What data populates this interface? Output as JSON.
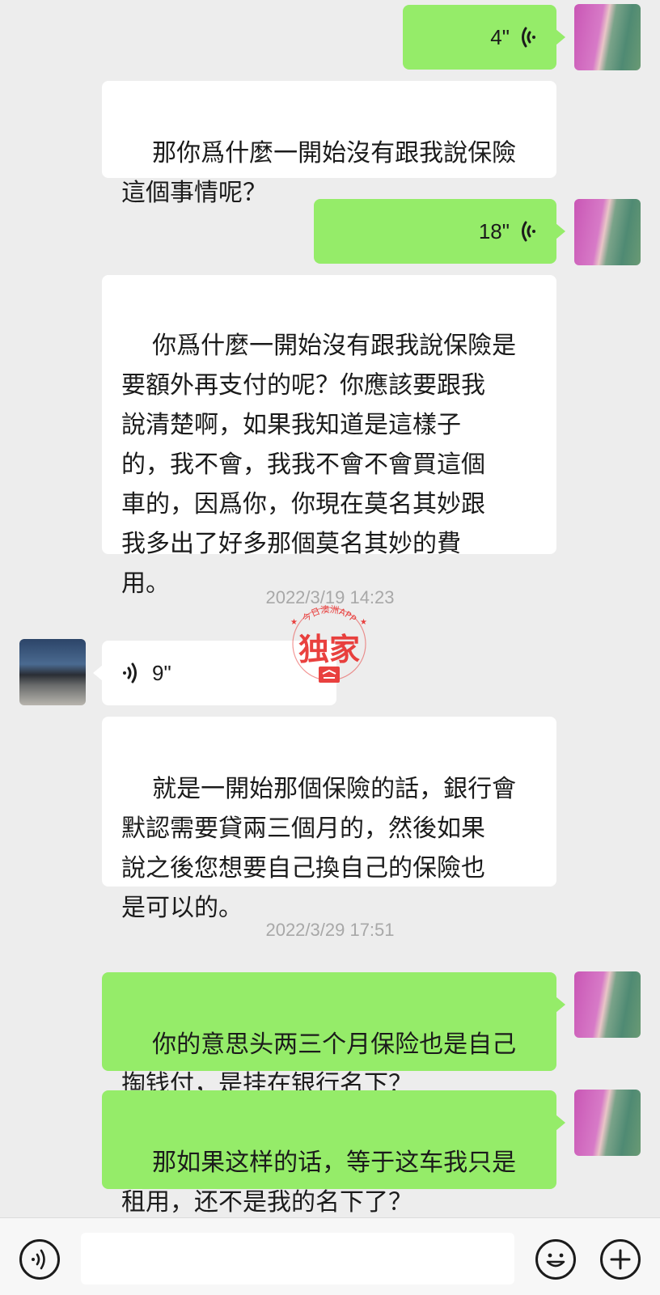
{
  "messages": [
    {
      "type": "voice",
      "from": "me",
      "duration": "4\""
    },
    {
      "type": "text",
      "from": "other",
      "text": "那你爲什麼一開始沒有跟我說保險\n這個事情呢？"
    },
    {
      "type": "voice",
      "from": "me",
      "duration": "18\""
    },
    {
      "type": "text",
      "from": "other",
      "text": "你爲什麼一開始沒有跟我說保險是\n要額外再支付的呢？你應該要跟我\n說清楚啊，如果我知道是這樣子\n的，我不會，我我不會不會買這個\n車的，因爲你，你現在莫名其妙跟\n我多出了好多那個莫名其妙的費\n用。"
    },
    {
      "type": "time",
      "text": "2022/3/19 14:23"
    },
    {
      "type": "voice",
      "from": "other",
      "duration": "9\""
    },
    {
      "type": "text",
      "from": "other",
      "text": "就是一開始那個保險的話，銀行會\n默認需要貸兩三個月的，然後如果\n說之後您想要自己換自己的保險也\n是可以的。"
    },
    {
      "type": "time",
      "text": "2022/3/29 17:51"
    },
    {
      "type": "text",
      "from": "me",
      "text": "你的意思头两三个月保险也是自己\n掏钱付，是挂在银行名下？"
    },
    {
      "type": "text",
      "from": "me",
      "text": "那如果这样的话，等于这车我只是\n租用，还不是我的名下了？"
    }
  ],
  "watermark": {
    "arc_text": "今日澳洲APP",
    "main_text": "独家",
    "color": "#e8312f"
  },
  "colors": {
    "background": "#ededed",
    "outgoing_bubble": "#95ec69",
    "incoming_bubble": "#ffffff",
    "timestamp": "#a8a8a8"
  },
  "bottom_bar": {
    "icons": [
      "voice-input-icon",
      "emoji-icon",
      "plus-icon"
    ]
  }
}
